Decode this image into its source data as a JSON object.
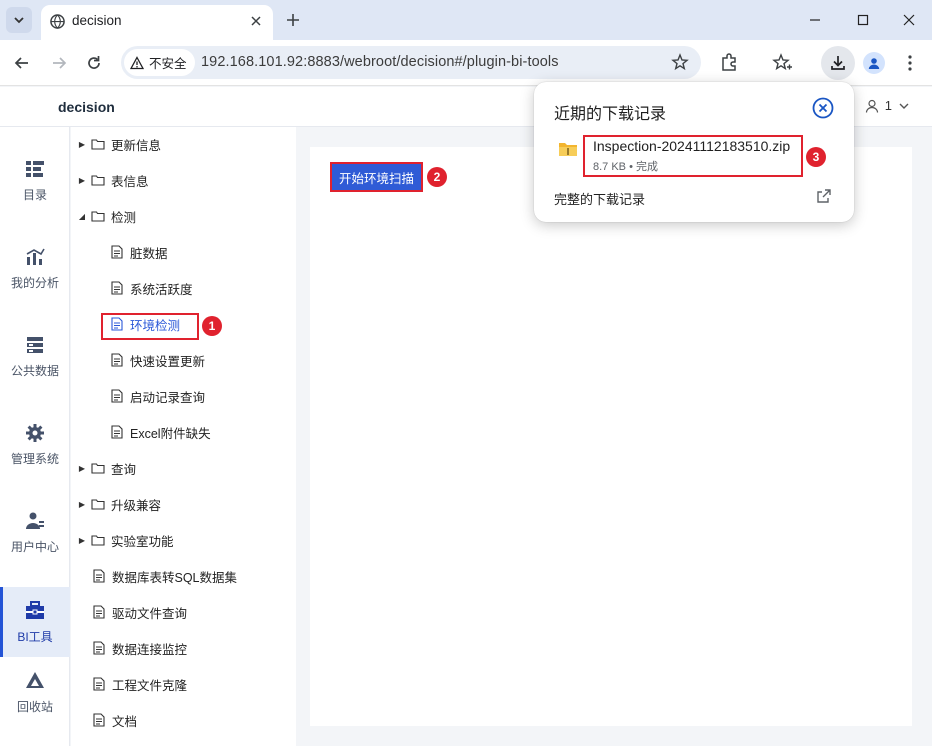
{
  "browser": {
    "tab_title": "decision",
    "security_label": "不安全",
    "url": "192.168.101.92:8883/webroot/decision#/plugin-bi-tools"
  },
  "app": {
    "title": "decision",
    "user": "1"
  },
  "rail": {
    "items": [
      {
        "label": "目录",
        "icon": "catalog-icon"
      },
      {
        "label": "我的分析",
        "icon": "analysis-icon"
      },
      {
        "label": "公共数据",
        "icon": "database-icon"
      },
      {
        "label": "管理系统",
        "icon": "gear-icon"
      },
      {
        "label": "用户中心",
        "icon": "user-icon"
      },
      {
        "label": "BI工具",
        "icon": "toolbox-icon",
        "active": true
      },
      {
        "label": "回收站",
        "icon": "recycle-icon"
      }
    ]
  },
  "tree": {
    "items": [
      {
        "label": "更新信息",
        "type": "folder",
        "expanded": false
      },
      {
        "label": "表信息",
        "type": "folder",
        "expanded": false
      },
      {
        "label": "检测",
        "type": "folder",
        "expanded": true
      },
      {
        "label": "脏数据",
        "type": "file"
      },
      {
        "label": "系统活跃度",
        "type": "file"
      },
      {
        "label": "环境检测",
        "type": "file",
        "active": true
      },
      {
        "label": "快速设置更新",
        "type": "file"
      },
      {
        "label": "启动记录查询",
        "type": "file"
      },
      {
        "label": "Excel附件缺失",
        "type": "file"
      },
      {
        "label": "查询",
        "type": "folder",
        "expanded": false
      },
      {
        "label": "升级兼容",
        "type": "folder",
        "expanded": false
      },
      {
        "label": "实验室功能",
        "type": "folder",
        "expanded": false
      },
      {
        "label": "数据库表转SQL数据集",
        "type": "file"
      },
      {
        "label": "驱动文件查询",
        "type": "file"
      },
      {
        "label": "数据连接监控",
        "type": "file"
      },
      {
        "label": "工程文件克隆",
        "type": "file"
      },
      {
        "label": "文档",
        "type": "file"
      }
    ]
  },
  "content": {
    "scan_button": "开始环境扫描"
  },
  "downloads": {
    "title": "近期的下载记录",
    "file_name": "Inspection-20241112183510.zip",
    "file_meta": "8.7 KB • 完成",
    "all_label": "完整的下载记录"
  },
  "markers": [
    "1",
    "2",
    "3"
  ],
  "colors": {
    "accent": "#2f5bd6",
    "highlight": "#e0222e",
    "active_text": "#2b58d8"
  }
}
